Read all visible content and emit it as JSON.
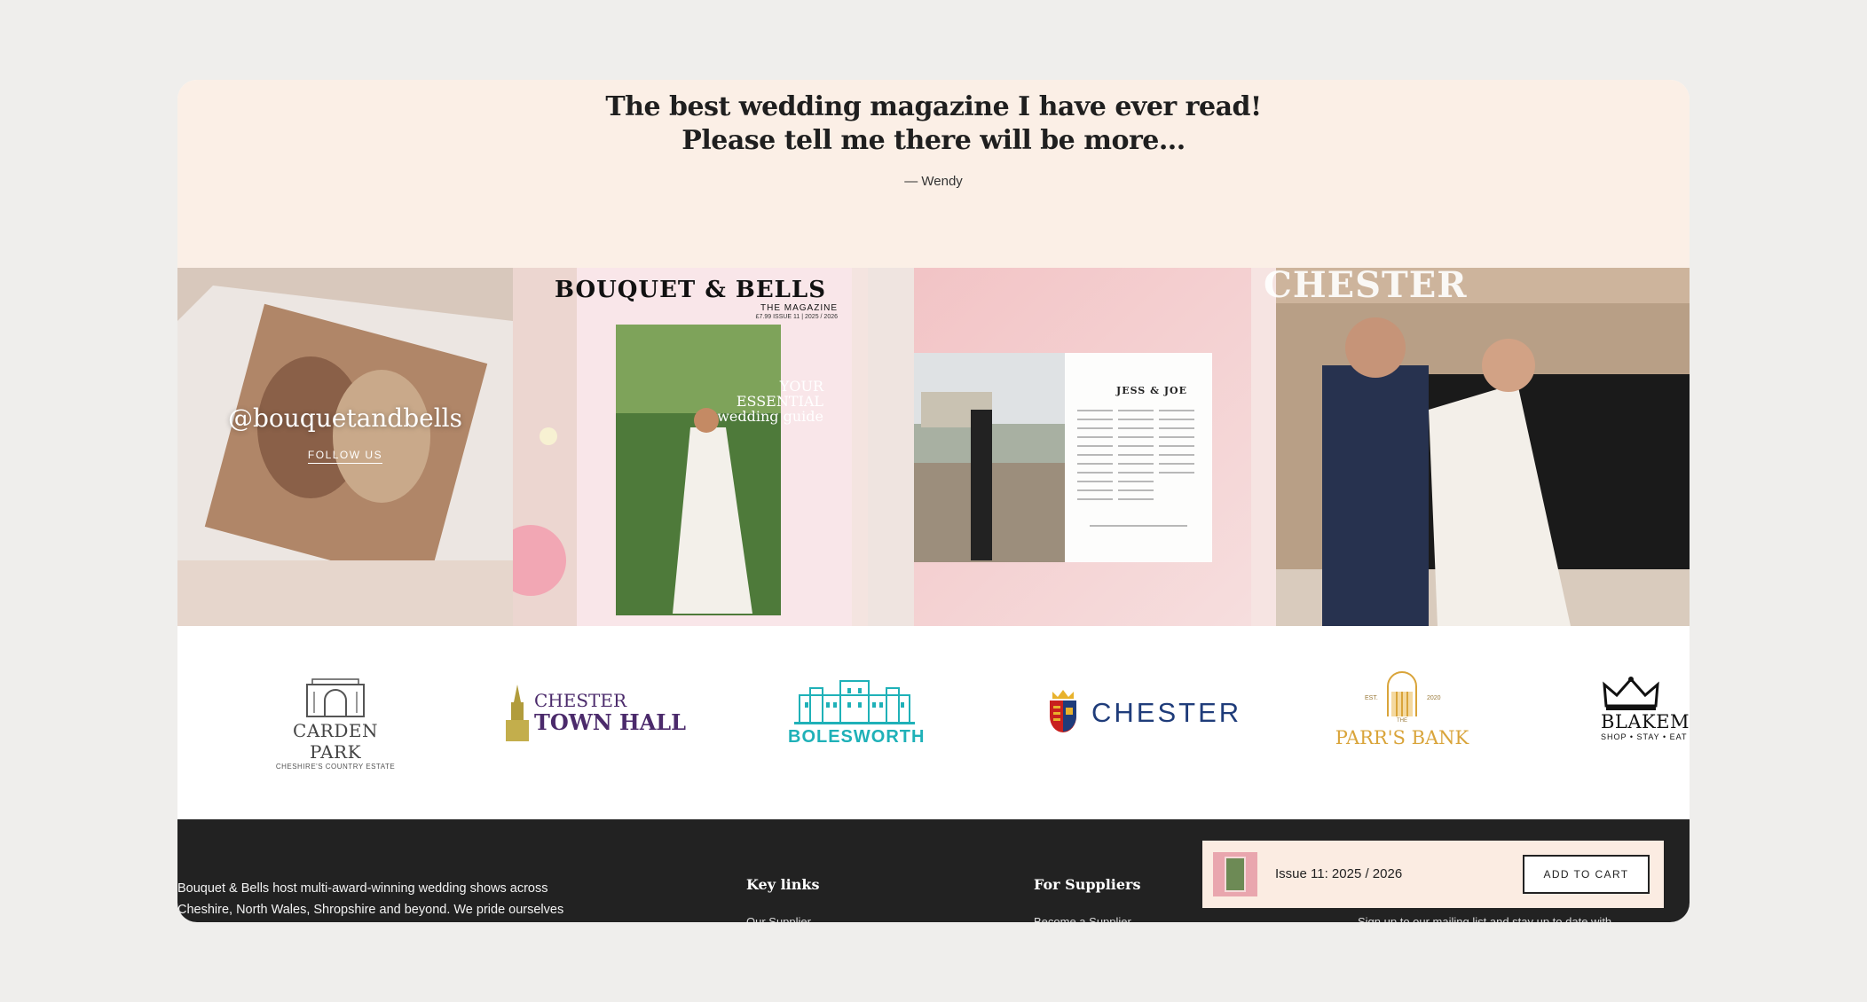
{
  "testimonial": {
    "quote": "The best wedding magazine I have ever read! Please tell me there will be more...",
    "author": "— Wendy"
  },
  "gallery": {
    "instagram": {
      "handle": "@bouquetandbells",
      "follow_label": "FOLLOW US"
    },
    "cover": {
      "title": "BOUQUET & BELLS",
      "subtitle": "THE MAGAZINE",
      "issue": "£7.99 ISSUE 11 | 2025 / 2026",
      "tagline": "YOUR ESSENTIAL wedding guide"
    },
    "spread": {
      "title": "JESS & JOE"
    },
    "photo": {
      "overlay_word": "CHESTER"
    }
  },
  "logos": [
    {
      "name": "CARDEN PARK",
      "sub": "CHESHIRE'S COUNTRY ESTATE"
    },
    {
      "name": "CHESTER",
      "name2": "TOWN HALL"
    },
    {
      "name": "BOLESWORTH"
    },
    {
      "name": "CHESTER"
    },
    {
      "name": "PARR'S BANK",
      "small": "THE",
      "est": "EST.",
      "year": "2020"
    },
    {
      "name": "BLAKEMERE",
      "sub": "SHOP • STAY • EAT"
    }
  ],
  "footer": {
    "about": "Bouquet & Bells host multi-award-winning wedding shows across Cheshire, North Wales, Shropshire and beyond. We pride ourselves",
    "key_links_title": "Key links",
    "key_links_first": "Our Supplier",
    "suppliers_title": "For Suppliers",
    "suppliers_first": "Become a Supplier",
    "newsletter_text": "Sign up to our mailing list and stay up to date with"
  },
  "cart": {
    "product_label": "Issue 11: 2025 / 2026",
    "button_label": "ADD TO CART"
  },
  "colors": {
    "testimonial_bg": "#fbefe6",
    "footer_bg": "#222222",
    "chester_blue": "#1f3c7a",
    "bolesworth_teal": "#1fb1b8",
    "parrs_gold": "#d9a43a",
    "town_hall_purple": "#4b2a6b"
  }
}
